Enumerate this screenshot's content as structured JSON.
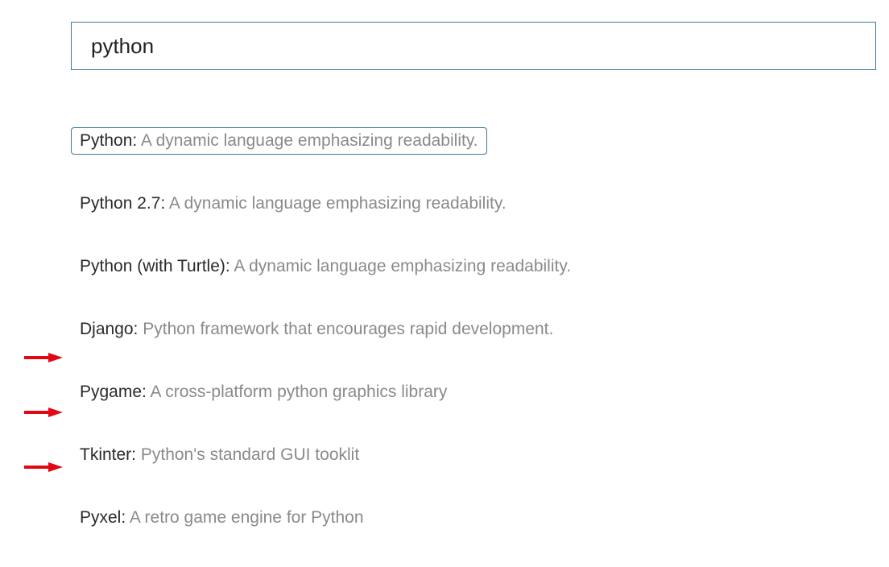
{
  "search": {
    "value": "python"
  },
  "results": [
    {
      "name": "Python:",
      "desc": " A dynamic language emphasizing readability.",
      "selected": true,
      "arrow": false
    },
    {
      "name": "Python 2.7:",
      "desc": " A dynamic language emphasizing readability.",
      "selected": false,
      "arrow": false
    },
    {
      "name": "Python (with Turtle):",
      "desc": " A dynamic language emphasizing readability.",
      "selected": false,
      "arrow": false
    },
    {
      "name": "Django:",
      "desc": " Python framework that encourages rapid development.",
      "selected": false,
      "arrow": false
    },
    {
      "name": "Pygame:",
      "desc": " A cross-platform python graphics library",
      "selected": false,
      "arrow": true
    },
    {
      "name": "Tkinter:",
      "desc": " Python's standard GUI tooklit",
      "selected": false,
      "arrow": true
    },
    {
      "name": "Pyxel:",
      "desc": " A retro game engine for Python",
      "selected": false,
      "arrow": true
    }
  ],
  "arrow_color": "#e30613"
}
